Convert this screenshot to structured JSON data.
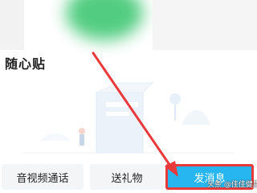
{
  "section": {
    "title": "随心贴"
  },
  "actions": {
    "av_call": "音视频通话",
    "send_gift": "送礼物",
    "send_message": "发消息"
  },
  "watermark": "头条 @佳佳健康",
  "colors": {
    "send_button": "#27b6f0",
    "highlight_arrow": "#e83a3a",
    "blur_green": "#33c46a"
  },
  "icons": {
    "annotation": "red-arrow-icon"
  }
}
